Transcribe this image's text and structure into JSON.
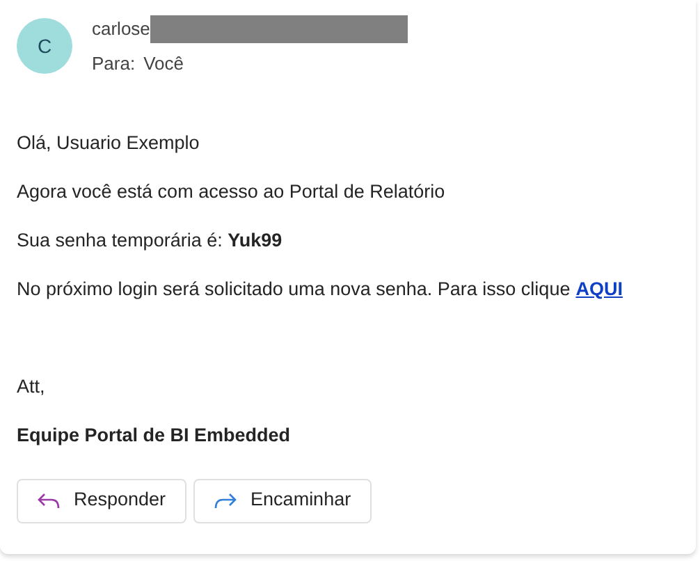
{
  "sender": {
    "initial": "C",
    "name": "carlose",
    "redacted": true,
    "to_label": "Para:",
    "to": "Você"
  },
  "body": {
    "greeting": "Olá, Usuario Exemplo",
    "line_1": "Agora você está com acesso ao Portal de Relatório",
    "line_2": "Sua senha temporária é: **Yuk99**",
    "line_3": "No próximo login será solicitado uma nova senha. Para isso clique",
    "link": "AQUI",
    "closing": "Att,",
    "signature": "Equipe Portal de BI Embedded"
  },
  "actions": [
    {
      "kind": "reply",
      "label": "Responder"
    },
    {
      "kind": "forward",
      "label": "Encaminhar"
    }
  ]
}
